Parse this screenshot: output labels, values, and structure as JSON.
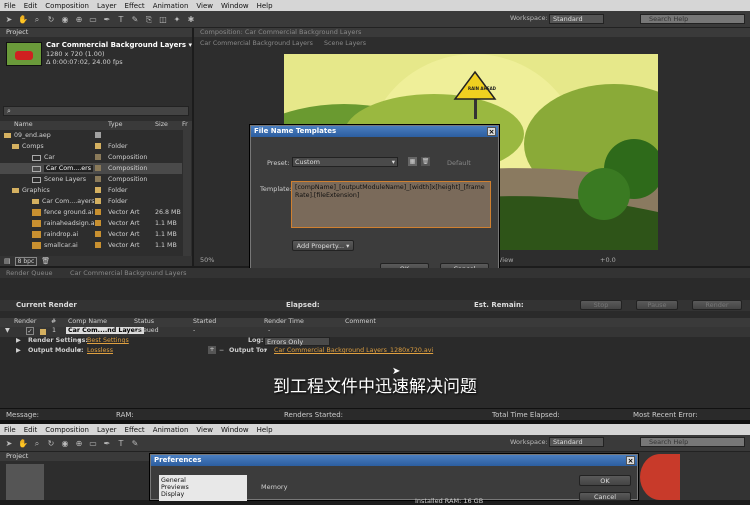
{
  "menu": [
    "File",
    "Edit",
    "Composition",
    "Layer",
    "Effect",
    "Animation",
    "View",
    "Window",
    "Help"
  ],
  "workspace": {
    "label": "Workspace:",
    "value": "Standard",
    "search_placeholder": "Search Help"
  },
  "project": {
    "tab": "Project",
    "comp_name": "Car Commercial Background Layers ▾",
    "comp_size": "1280 x 720 (1.00)",
    "comp_duration": "Δ 0:00:07:02, 24.00 fps",
    "columns": [
      "Name",
      "Type",
      "Size",
      "Fr"
    ],
    "items": [
      {
        "name": "09_end.aep",
        "type": "",
        "size": ""
      },
      {
        "name": "Comps",
        "type": "Folder",
        "size": ""
      },
      {
        "name": "Car",
        "type": "Composition",
        "size": ""
      },
      {
        "name": "Car Com....ers",
        "type": "Composition",
        "size": ""
      },
      {
        "name": "Scene Layers",
        "type": "Composition",
        "size": ""
      },
      {
        "name": "Graphics",
        "type": "Folder",
        "size": ""
      },
      {
        "name": "Car Com....ayers",
        "type": "Folder",
        "size": ""
      },
      {
        "name": "fence ground.ai",
        "type": "Vector Art",
        "size": "26.8 MB"
      },
      {
        "name": "rainaheadsign.ai",
        "type": "Vector Art",
        "size": "1.1 MB"
      },
      {
        "name": "raindrop.ai",
        "type": "Vector Art",
        "size": "1.1 MB"
      },
      {
        "name": "smallcar.ai",
        "type": "Vector Art",
        "size": "1.1 MB"
      }
    ],
    "bpc": "8 bpc"
  },
  "composition": {
    "tab": "Composition: Car Commercial Background Layers",
    "subtabs": [
      "Car Commercial Background Layers",
      "Scene Layers"
    ],
    "zoom": "50%",
    "view": "View",
    "offset": "+0.0",
    "sign_text": "RAIN AHEAD"
  },
  "file_name_dialog": {
    "title": "File Name Templates",
    "preset_label": "Preset:",
    "preset_value": "Custom",
    "default_label": "Default",
    "template_label": "Template:",
    "template_value": "[compName]_[outputModuleName]_[width]x[height]_[frameRate].[fileExtension]",
    "add_property": "Add Property...",
    "ok": "OK",
    "cancel": "Cancel"
  },
  "render_queue": {
    "tab": "Render Queue",
    "tab2": "Car Commercial Background Layers",
    "current_render": "Current Render",
    "elapsed": "Elapsed:",
    "est_remain": "Est. Remain:",
    "stop": "Stop",
    "pause": "Pause",
    "render": "Render",
    "columns": [
      "Render",
      "#",
      "Comp Name",
      "Status",
      "Started",
      "Render Time",
      "Comment"
    ],
    "item_num": "1",
    "item_comp": "Car Com....nd Layers",
    "item_status": "Queued",
    "item_started": "-",
    "item_render_time": "-",
    "render_settings_label": "Render Settings:",
    "render_settings_value": "Best Settings",
    "log_label": "Log:",
    "log_value": "Errors Only",
    "output_module_label": "Output Module:",
    "output_module_value": "Lossless",
    "output_to_label": "Output To:",
    "output_to_value": "Car Commercial Background Layers_1280x720.avi"
  },
  "subtitle": "到工程文件中迅速解决问题",
  "statusbar": {
    "message": "Message:",
    "ram": "RAM:",
    "renders_started": "Renders Started:",
    "total_time": "Total Time Elapsed:",
    "recent_error": "Most Recent Error:"
  },
  "second": {
    "project_tab": "Project",
    "dialog_title": "Preferences",
    "categories": [
      "General",
      "Previews",
      "Display"
    ],
    "memory": "Memory",
    "installed_ram": "Installed RAM: 16 GB",
    "ok": "OK",
    "cancel": "Cancel"
  },
  "colors": {
    "accent_blue": "#2c5ea0",
    "folder": "#d4b060",
    "composition": "#8a7a5a",
    "vector": "#c89030",
    "link": "#e0a040"
  }
}
